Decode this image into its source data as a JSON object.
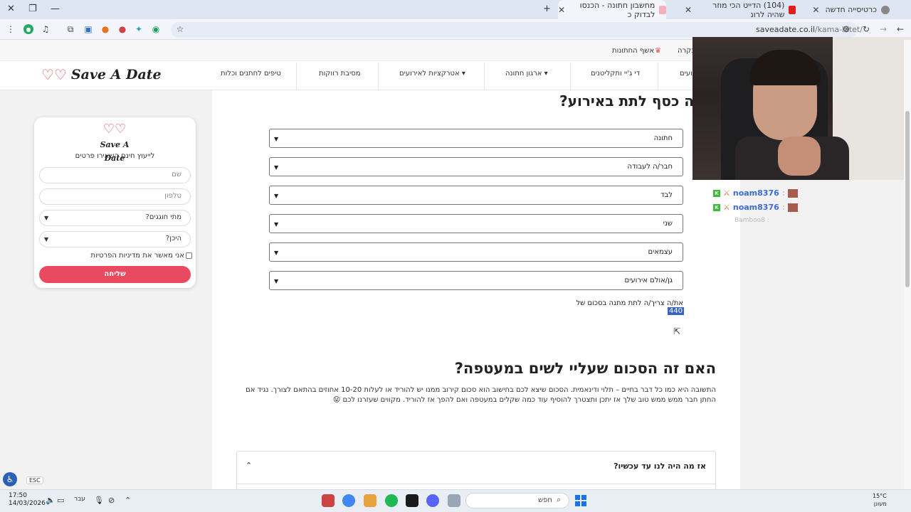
{
  "browser": {
    "tabs": [
      {
        "title": "כרטיסייה חדשה"
      },
      {
        "title": "(104) הדייט הכי מוזר שהיה לרונ"
      },
      {
        "title": "מחשבון חתונה - הכנסו לבדוק כ"
      }
    ],
    "url_host": "saveadate.co.il",
    "url_path": "/kama-latet/"
  },
  "site": {
    "top_links": {
      "visit": "בקרה",
      "wishes": "אשף החתונות"
    },
    "logo_text": "Save A Date",
    "nav": [
      {
        "label": "יועים"
      },
      {
        "label": "די ג'יי ותקליטנים"
      },
      {
        "label": "ארגון חתונה"
      },
      {
        "label": "אטרקציות לאירועים"
      },
      {
        "label": "מסיבת רווקות"
      },
      {
        "label": "טיפים לחתנים וכלות"
      }
    ]
  },
  "form": {
    "logo_text": "Save A Date",
    "subtitle": "לייעוץ חינם השאירו פרטים",
    "name_placeholder": "שם",
    "phone_placeholder": "טלפון",
    "when_label": "מתי חוגגים?",
    "where_label": "היכן?",
    "privacy_label": "אני מאשר את מדיניות הפרטיות",
    "submit_label": "שליחה"
  },
  "calculator": {
    "title": "ה כסף לתת באירוע?",
    "selects": [
      {
        "value": "חתונה"
      },
      {
        "value": "חבר/ה לעבודה"
      },
      {
        "value": "לבד"
      },
      {
        "value": "שני"
      },
      {
        "value": "עצמאים"
      },
      {
        "value": "גן/אולם אירועים"
      }
    ],
    "result_text": "את/ה צריך/ה לתת מתנה בסכום של",
    "result_value": "440"
  },
  "article": {
    "heading": "האם זה הסכום שעליי לשים במעטפה?",
    "paragraph": "התשובה היא כמו כל דבר בחיים – תלוי ודינאמית. הסכום שיצא לכם בחישוב הוא סכום קירוב ממנו יש להוריד או לעלות 10-20 אחוזים בהתאם לצורך. נגיד אם החתן חבר ממש ממש טוב שלך אז יתכן ותצטרך להוסיף עוד כמה שקלים במעטפה ואם להפך אז להוריד. מקווים שעזרנו לכם 😜",
    "accordion_title": "אז מה היה לנו עד עכשיו?"
  },
  "overlay": {
    "chat": [
      {
        "user": "noam8376"
      },
      {
        "user": "noam8376"
      }
    ],
    "chat_faded": "Bamboo8 :"
  },
  "a11y": {
    "esc": "ESC"
  },
  "taskbar": {
    "time": "17:50",
    "date": "14/03/2026",
    "lang": "עבר",
    "search": "חפש",
    "temp": "15°C",
    "weather": "מעונן"
  },
  "colors": {
    "brand": "#ea4a5f",
    "selection": "#3b63c4",
    "chat_user": "#3b6bd6"
  }
}
